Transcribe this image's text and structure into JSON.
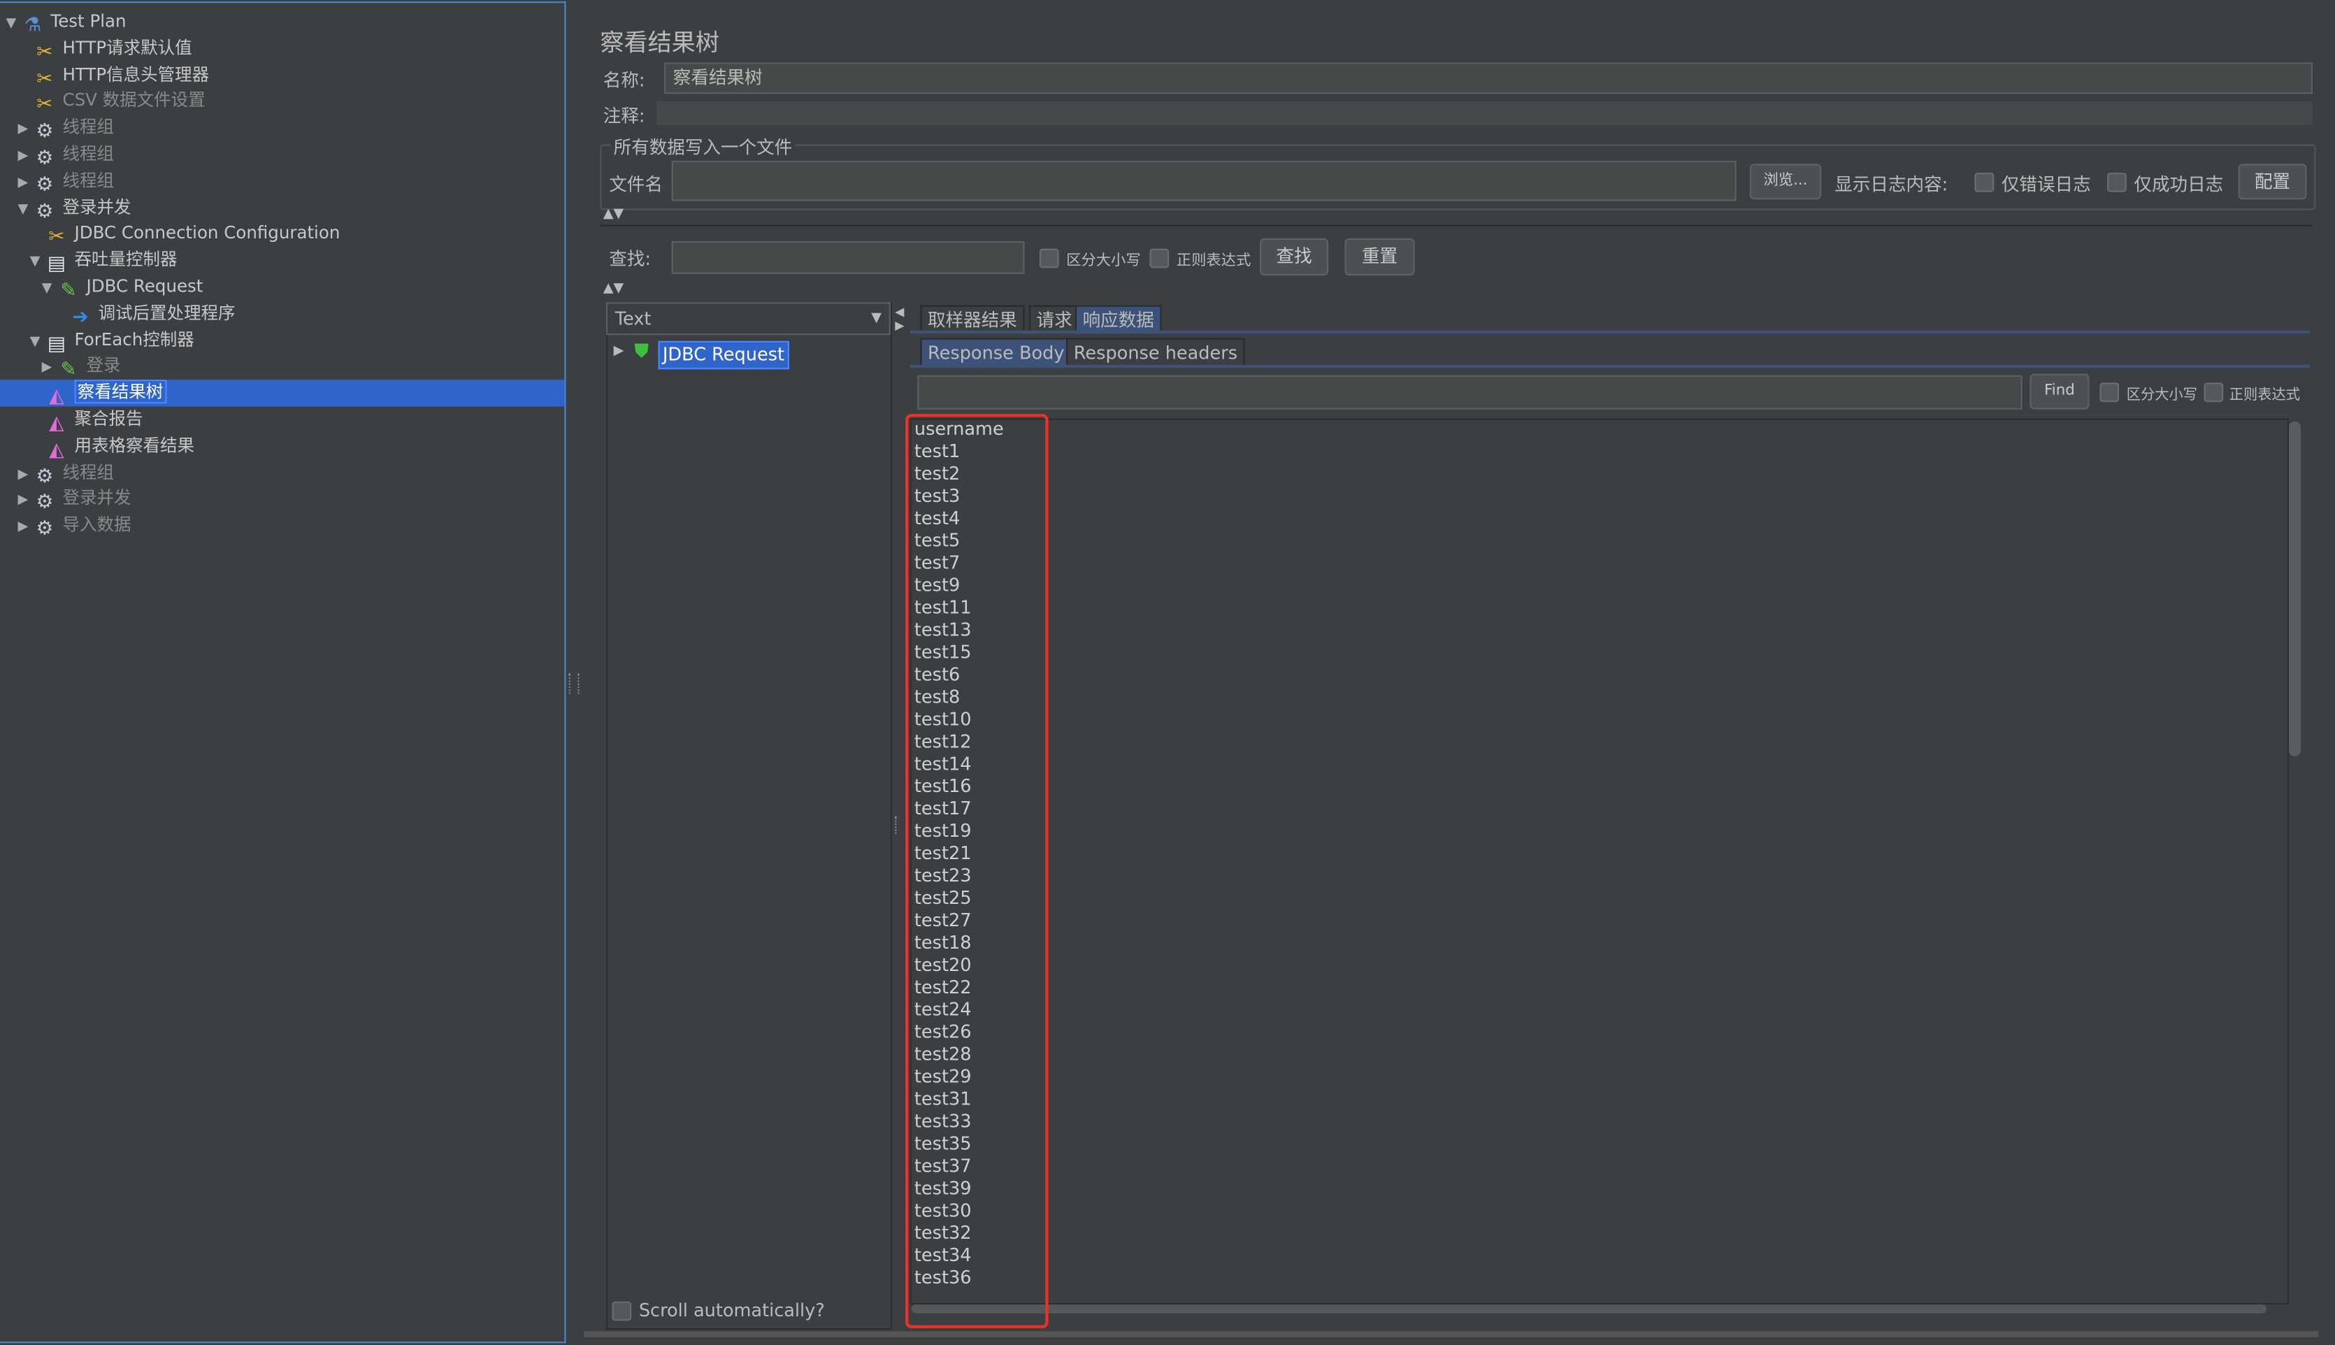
{
  "tree": [
    {
      "label": "Test Plan",
      "icon": "test-plan-flask-icon",
      "indent": 0,
      "toggle": "expanded",
      "disabled": false
    },
    {
      "label": "HTTP请求默认值",
      "icon": "config-wrench-icon",
      "indent": 1,
      "toggle": "",
      "disabled": false
    },
    {
      "label": "HTTP信息头管理器",
      "icon": "config-wrench-icon",
      "indent": 1,
      "toggle": "",
      "disabled": false
    },
    {
      "label": "CSV 数据文件设置",
      "icon": "config-wrench-icon",
      "indent": 1,
      "toggle": "",
      "disabled": true
    },
    {
      "label": "线程组",
      "icon": "thread-group-gear-icon",
      "indent": 1,
      "toggle": "collapsed",
      "disabled": true
    },
    {
      "label": "线程组",
      "icon": "thread-group-gear-icon",
      "indent": 1,
      "toggle": "collapsed",
      "disabled": true
    },
    {
      "label": "线程组",
      "icon": "thread-group-gear-icon",
      "indent": 1,
      "toggle": "collapsed",
      "disabled": true
    },
    {
      "label": "登录并发",
      "icon": "thread-group-gear-icon",
      "indent": 1,
      "toggle": "expanded",
      "disabled": false
    },
    {
      "label": "JDBC Connection Configuration",
      "icon": "config-wrench-icon",
      "indent": 2,
      "toggle": "",
      "disabled": false
    },
    {
      "label": "吞吐量控制器",
      "icon": "controller-icon",
      "indent": 2,
      "toggle": "expanded",
      "disabled": false
    },
    {
      "label": "JDBC Request",
      "icon": "sampler-pipette-icon",
      "indent": 3,
      "toggle": "expanded",
      "disabled": false
    },
    {
      "label": "调试后置处理程序",
      "icon": "post-processor-icon",
      "indent": 4,
      "toggle": "",
      "disabled": false
    },
    {
      "label": "ForEach控制器",
      "icon": "controller-icon",
      "indent": 2,
      "toggle": "expanded",
      "disabled": false
    },
    {
      "label": "登录",
      "icon": "sampler-pipette-icon",
      "indent": 3,
      "toggle": "collapsed",
      "disabled": true
    },
    {
      "label": "察看结果树",
      "icon": "listener-graph-icon",
      "indent": 2,
      "toggle": "",
      "disabled": false,
      "selected": true
    },
    {
      "label": "聚合报告",
      "icon": "listener-graph-icon",
      "indent": 2,
      "toggle": "",
      "disabled": false
    },
    {
      "label": "用表格察看结果",
      "icon": "listener-graph-icon",
      "indent": 2,
      "toggle": "",
      "disabled": false
    },
    {
      "label": "线程组",
      "icon": "thread-group-gear-icon",
      "indent": 1,
      "toggle": "collapsed",
      "disabled": true
    },
    {
      "label": "登录并发",
      "icon": "thread-group-gear-icon",
      "indent": 1,
      "toggle": "collapsed",
      "disabled": true
    },
    {
      "label": "导入数据",
      "icon": "thread-group-gear-icon",
      "indent": 1,
      "toggle": "collapsed",
      "disabled": true
    }
  ],
  "panel": {
    "title": "察看结果树",
    "name_label": "名称:",
    "name_value": "察看结果树",
    "comment_label": "注释:",
    "comment_value": "",
    "file_group": "所有数据写入一个文件",
    "filename_label": "文件名",
    "filename_value": "",
    "browse": "浏览...",
    "log_label": "显示日志内容:",
    "errors_only": "仅错误日志",
    "success_only": "仅成功日志",
    "configure": "配置",
    "search_label": "查找:",
    "search_value": "",
    "case_sensitive": "区分大小写",
    "regex": "正则表达式",
    "search_btn": "查找",
    "reset_btn": "重置"
  },
  "results": {
    "renderer": "Text",
    "item": "JDBC Request",
    "scroll_auto": "Scroll automatically?",
    "tabs": [
      "取样器结果",
      "请求",
      "响应数据"
    ],
    "active_tab": "响应数据",
    "subtabs": [
      "Response Body",
      "Response headers"
    ],
    "active_subtab": "Response Body",
    "find_btn": "Find",
    "find_case": "区分大小写",
    "find_regex": "正则表达式",
    "body_lines": [
      "username",
      "test1",
      "test2",
      "test3",
      "test4",
      "test5",
      "test7",
      "test9",
      "test11",
      "test13",
      "test15",
      "test6",
      "test8",
      "test10",
      "test12",
      "test14",
      "test16",
      "test17",
      "test19",
      "test21",
      "test23",
      "test25",
      "test27",
      "test18",
      "test20",
      "test22",
      "test24",
      "test26",
      "test28",
      "test29",
      "test31",
      "test33",
      "test35",
      "test37",
      "test39",
      "test30",
      "test32",
      "test34",
      "test36"
    ],
    "highlight_color": "#e8322a"
  },
  "colors": {
    "selection": "#2f65ca",
    "background": "#3c3f41",
    "active_tab": "#3d5279"
  }
}
